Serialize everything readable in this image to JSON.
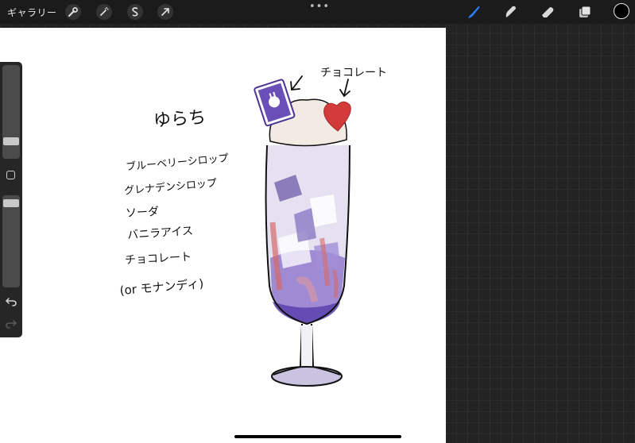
{
  "topbar": {
    "gallery_label": "ギャラリー",
    "more_menu": "•••"
  },
  "colors": {
    "brush_active": "#2f7bf5",
    "current_color": "#000000"
  },
  "drawing": {
    "title_text": "ゆらち",
    "recipe": [
      "ブルーベリーシロップ",
      "グレナデンシロップ",
      "ソーダ",
      "バニラアイス",
      "チョコレート",
      "(or モナンディ)"
    ],
    "annotation": "チョコレート"
  },
  "sidebar": {
    "brush_size_level": 0.3,
    "opacity_level": 0.95
  }
}
